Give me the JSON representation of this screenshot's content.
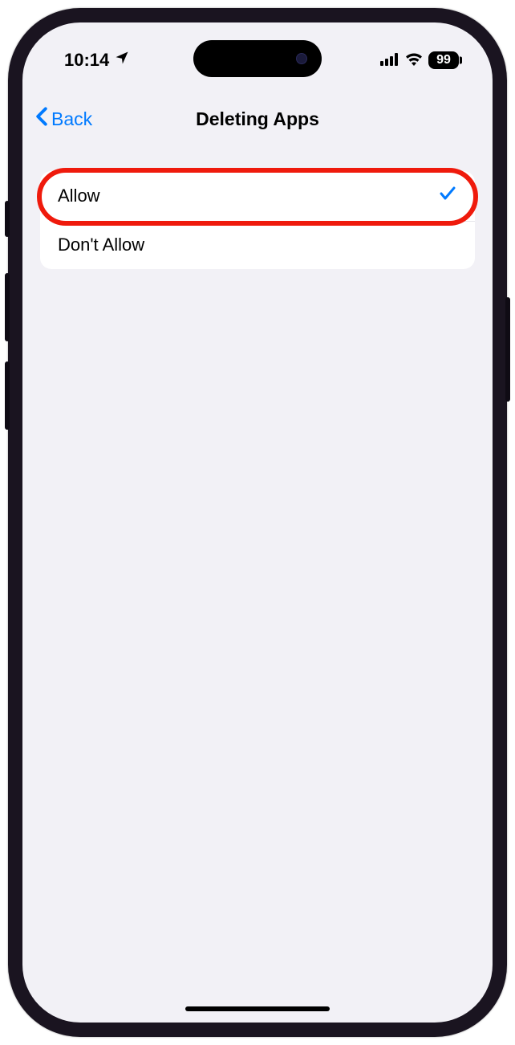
{
  "status": {
    "time": "10:14",
    "battery": "99"
  },
  "nav": {
    "back_label": "Back",
    "title": "Deleting Apps"
  },
  "options": {
    "allow": {
      "label": "Allow",
      "selected": true
    },
    "dont_allow": {
      "label": "Don't Allow",
      "selected": false
    }
  }
}
